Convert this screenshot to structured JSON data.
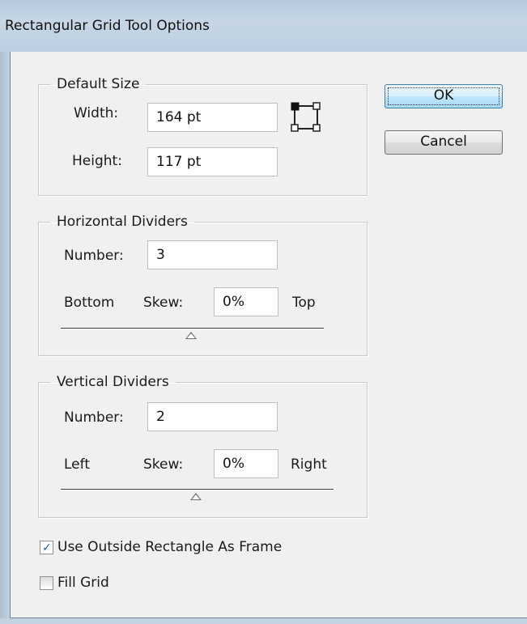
{
  "window": {
    "title": "Rectangular Grid Tool Options"
  },
  "default_size": {
    "legend": "Default Size",
    "width_label": "Width:",
    "width_value": "164 pt",
    "height_label": "Height:",
    "height_value": "117 pt",
    "reference_point_icon": "reference-point-icon"
  },
  "horizontal_dividers": {
    "legend": "Horizontal Dividers",
    "number_label": "Number:",
    "number_value": "3",
    "left_end_label": "Bottom",
    "skew_label": "Skew:",
    "skew_value": "0%",
    "right_end_label": "Top",
    "skew_slider_position": 0.5
  },
  "vertical_dividers": {
    "legend": "Vertical Dividers",
    "number_label": "Number:",
    "number_value": "2",
    "left_end_label": "Left",
    "skew_label": "Skew:",
    "skew_value": "0%",
    "right_end_label": "Right",
    "skew_slider_position": 0.5
  },
  "options": {
    "use_outside_rectangle_label": "Use Outside Rectangle As Frame",
    "use_outside_rectangle_checked": true,
    "fill_grid_label": "Fill Grid",
    "fill_grid_checked": false
  },
  "buttons": {
    "ok_label": "OK",
    "cancel_label": "Cancel"
  },
  "colors": {
    "titlebar": "#bccfe1",
    "dialog_background": "#f0f0f0",
    "default_button": "#bee6fd",
    "checkmark": "#1c5fa8"
  }
}
